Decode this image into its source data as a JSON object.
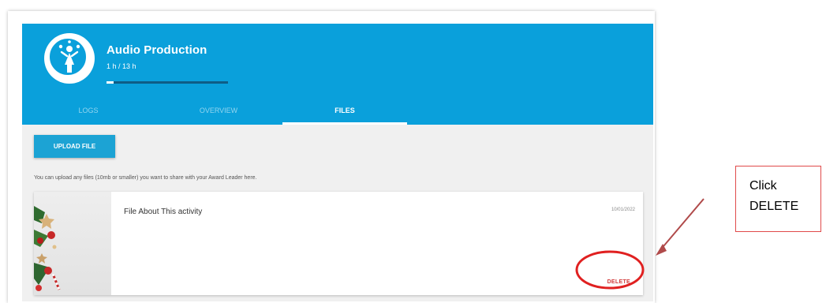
{
  "activity": {
    "title": "Audio Production",
    "hours_label": "1 h / 13 h",
    "progress_fraction": 0.06
  },
  "tabs": [
    {
      "label": "LOGS",
      "active": false
    },
    {
      "label": "OVERVIEW",
      "active": false
    },
    {
      "label": "FILES",
      "active": true
    }
  ],
  "files_panel": {
    "upload_label": "UPLOAD FILE",
    "hint": "You can upload any files (10mb or smaller) you want to share with your Award Leader here.",
    "file": {
      "name": "File About This activity",
      "date": "10/01/2022",
      "delete_label": "DELETE"
    }
  },
  "annotation": {
    "line1": "Click",
    "line2": "DELETE",
    "color": "#e02020"
  },
  "colors": {
    "header": "#0aa0db",
    "button": "#1ca3d4",
    "delete": "#d23b3b"
  },
  "icons": {
    "activity": "person-juggling-icon",
    "thumbnail": "christmas-decoration-image"
  }
}
